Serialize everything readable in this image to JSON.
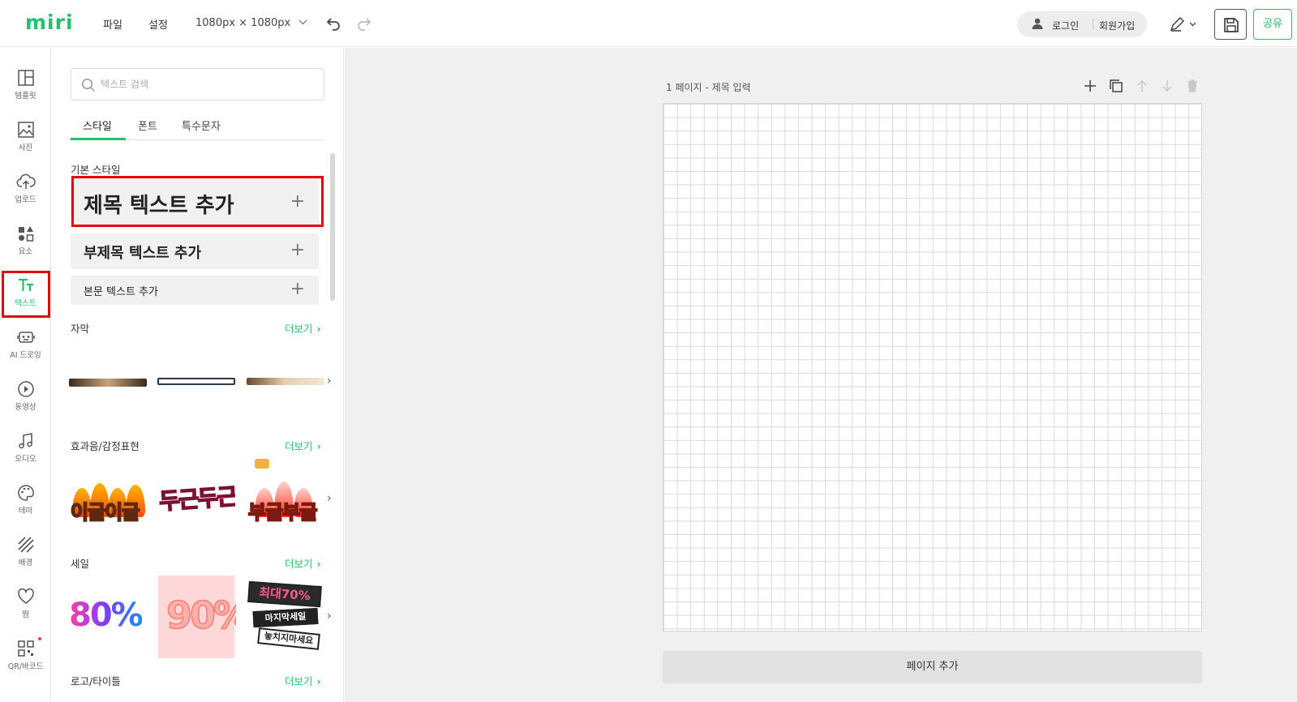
{
  "app": {
    "logo": "miri",
    "menu_file": "파일",
    "menu_settings": "설정",
    "canvas_size": "1080px × 1080px"
  },
  "account": {
    "login": "로그인",
    "signup": "회원가입",
    "share": "공유"
  },
  "rail": {
    "items": [
      {
        "label": "템플릿",
        "icon": "layout-icon"
      },
      {
        "label": "사진",
        "icon": "image-icon"
      },
      {
        "label": "업로드",
        "icon": "upload-cloud-icon"
      },
      {
        "label": "요소",
        "icon": "shapes-icon"
      },
      {
        "label": "텍스트",
        "icon": "text-icon",
        "active": true
      },
      {
        "label": "AI 드로잉",
        "icon": "robot-icon"
      },
      {
        "label": "동영상",
        "icon": "play-circle-icon"
      },
      {
        "label": "오디오",
        "icon": "music-note-icon"
      },
      {
        "label": "테마",
        "icon": "palette-icon"
      },
      {
        "label": "배경",
        "icon": "background-pattern-icon"
      },
      {
        "label": "찜",
        "icon": "heart-icon"
      },
      {
        "label": "QR/바코드",
        "icon": "qr-code-icon"
      }
    ],
    "accent_color": "#23c16b",
    "highlight_color": "#e3000f"
  },
  "panel": {
    "search_placeholder": "텍스트 검색",
    "tabs": [
      "스타일",
      "폰트",
      "특수문자"
    ],
    "basic_style_title": "기본 스타일",
    "heading_button": "제목 텍스트 추가",
    "subheading_button": "부제목 텍스트 추가",
    "body_button": "본문 텍스트 추가",
    "more_label": "더보기",
    "sections": [
      {
        "title": "자막"
      },
      {
        "title": "효과음/감정표현",
        "thumbs": [
          "이글이글",
          "두근두근",
          "부글부글"
        ]
      },
      {
        "title": "세일",
        "thumbs": [
          "80%",
          "90%",
          "최대70%",
          "마지막세일",
          "놓치지마세요"
        ]
      },
      {
        "title": "로고/타이틀"
      }
    ]
  },
  "canvas": {
    "page_title": "1 페이지 - 제목 입력",
    "add_page": "페이지 추가"
  }
}
